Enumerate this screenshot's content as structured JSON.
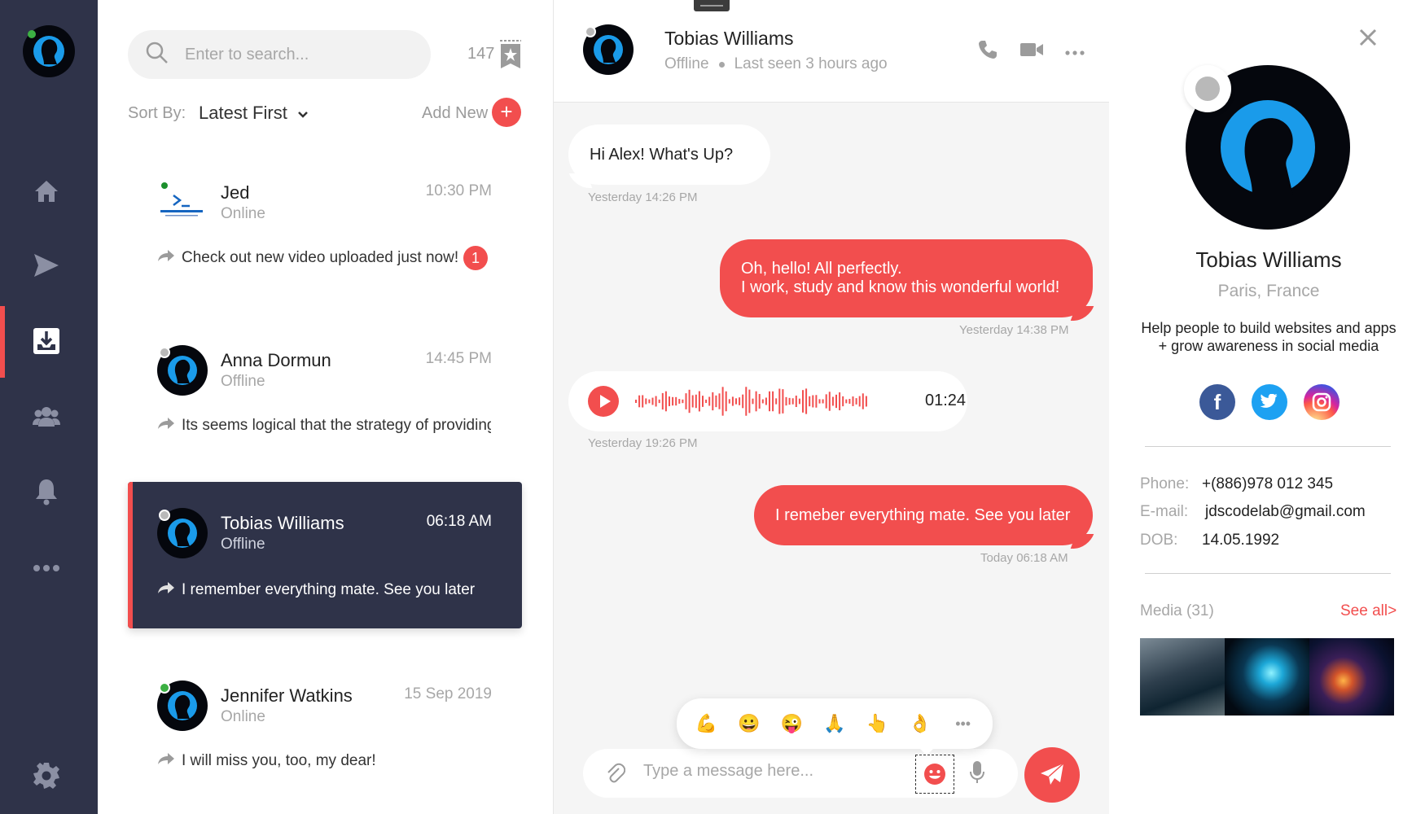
{
  "colors": {
    "accent": "#f24e4e",
    "rail": "#2f3349",
    "online": "#3cb043",
    "offline": "#b9b9b9"
  },
  "rail": {
    "items": [
      {
        "icon": "home-icon"
      },
      {
        "icon": "send-icon"
      },
      {
        "icon": "inbox-icon",
        "active": true
      },
      {
        "icon": "users-icon"
      },
      {
        "icon": "bell-icon"
      },
      {
        "icon": "more-icon"
      }
    ],
    "settings_icon": "gear-icon"
  },
  "contacts": {
    "search_placeholder": "Enter to search...",
    "count": "147",
    "sort_label": "Sort By:",
    "sort_value": "Latest First",
    "add_new_label": "Add New",
    "add_symbol": "+",
    "items": [
      {
        "name": "Jed",
        "status": "Online",
        "time": "10:30 PM",
        "preview": "Check out new video uploaded just now!",
        "unread": "1"
      },
      {
        "name": "Anna Dormun",
        "status": "Offline",
        "time": "14:45 PM",
        "preview": "Its seems logical that the strategy of providing!"
      },
      {
        "name": "Tobias Williams",
        "status": "Offline",
        "time": "06:18 AM",
        "preview": "I remember everything mate. See you later",
        "active": true
      },
      {
        "name": "Jennifer Watkins",
        "status": "Online",
        "time": "15 Sep 2019",
        "preview": "I will miss you, too, my dear!"
      }
    ]
  },
  "chat": {
    "name": "Tobias Williams",
    "status": "Offline",
    "last_seen": "Last seen 3 hours ago",
    "messages": [
      {
        "dir": "in",
        "lines": [
          "Hi Alex!  What's Up?"
        ],
        "stamp": "Yesterday 14:26 PM"
      },
      {
        "dir": "out",
        "lines": [
          "Oh, hello!  All perfectly.",
          "I work, study and know this wonderful world!"
        ],
        "stamp": "Yesterday 14:38 PM"
      },
      {
        "dir": "in",
        "voice_duration": "01:24",
        "stamp": "Yesterday 19:26 PM"
      },
      {
        "dir": "out",
        "lines": [
          "I remeber everything mate. See you later"
        ],
        "stamp": "Today 06:18 AM"
      }
    ],
    "emojis": [
      "💪",
      "😀",
      "😜",
      "🙏",
      "👆",
      "👌"
    ],
    "more_emojis": "•••",
    "input_placeholder": "Type a message here..."
  },
  "profile": {
    "name": "Tobias Williams",
    "location": "Paris, France",
    "bio_line1": "Help people to build websites and apps",
    "bio_line2": "+ grow awareness in social media",
    "socials": [
      "facebook-icon",
      "twitter-icon",
      "instagram-icon"
    ],
    "phone_label": "Phone:",
    "phone": "+(886)978 012 345",
    "email_label": "E-mail:",
    "email": "jdscodelab@gmail.com",
    "dob_label": "DOB:",
    "dob": "14.05.1992",
    "media_title": "Media (31)",
    "see_all": "See all>"
  }
}
